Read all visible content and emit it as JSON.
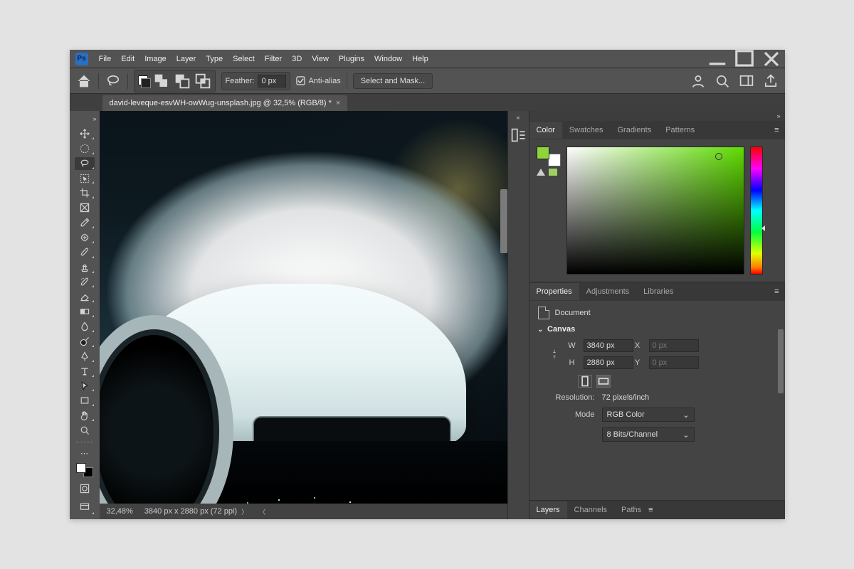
{
  "menubar": {
    "items": [
      "File",
      "Edit",
      "Image",
      "Layer",
      "Type",
      "Select",
      "Filter",
      "3D",
      "View",
      "Plugins",
      "Window",
      "Help"
    ]
  },
  "optionsbar": {
    "feather_label": "Feather:",
    "feather_value": "0 px",
    "antialias_label": "Anti-alias",
    "select_mask": "Select and Mask..."
  },
  "tab": {
    "title": "david-leveque-esvWH-owWug-unsplash.jpg @ 32,5% (RGB/8) *"
  },
  "status": {
    "zoom": "32,48%",
    "dimensions": "3840 px x 2880 px (72 ppi)"
  },
  "panels": {
    "color_tabs": [
      "Color",
      "Swatches",
      "Gradients",
      "Patterns"
    ],
    "props_tabs": [
      "Properties",
      "Adjustments",
      "Libraries"
    ],
    "layers_tabs": [
      "Layers",
      "Channels",
      "Paths"
    ]
  },
  "properties": {
    "doc_label": "Document",
    "section": "Canvas",
    "w_label": "W",
    "h_label": "H",
    "x_label": "X",
    "y_label": "Y",
    "w_value": "3840 px",
    "h_value": "2880 px",
    "x_value": "0 px",
    "y_value": "0 px",
    "resolution_label": "Resolution:",
    "resolution_value": "72 pixels/inch",
    "mode_label": "Mode",
    "mode_value": "RGB Color",
    "bits_value": "8 Bits/Channel"
  },
  "colors": {
    "foreground": "#8fd53a",
    "background_swatch": "#ffffff"
  }
}
